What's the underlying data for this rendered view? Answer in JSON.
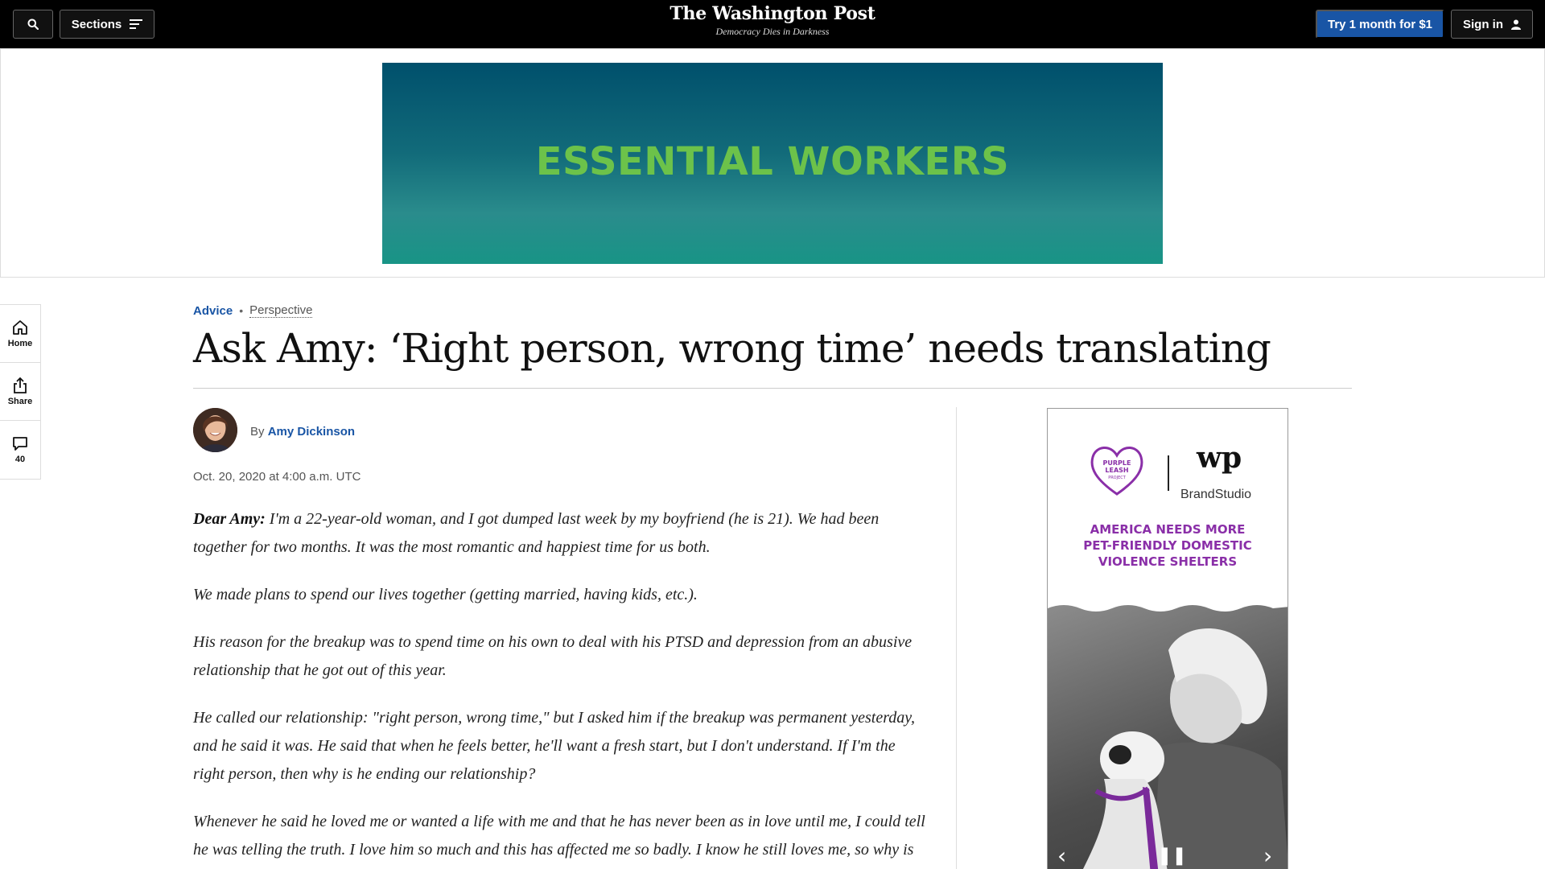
{
  "nav": {
    "sections_label": "Sections",
    "logo_title": "The Washington Post",
    "logo_tagline": "Democracy Dies in Darkness",
    "try_label": "Try 1 month for $1",
    "signin_label": "Sign in"
  },
  "top_ad": {
    "text": "ESSENTIAL WORKERS",
    "accent": "#6cc24a"
  },
  "rail": {
    "home_label": "Home",
    "share_label": "Share",
    "comments_count": "40"
  },
  "article": {
    "section": "Advice",
    "label": "Perspective",
    "headline": "Ask Amy: ‘Right person, wrong time’ needs translating",
    "byline_prefix": "By",
    "author": "Amy Dickinson",
    "date": "Oct. 20, 2020 at 4:00 a.m. UTC",
    "salutation": "Dear Amy:",
    "paragraphs": [
      " I'm a 22-year-old woman, and I got dumped last week by my boyfriend (he is 21). We had been together for two months. It was the most romantic and happiest time for us both.",
      "We made plans to spend our lives together (getting married, having kids, etc.).",
      "His reason for the breakup was to spend time on his own to deal with his PTSD and depression from an abusive relationship that he got out of this year.",
      "He called our relationship: \"right person, wrong time,\" but I asked him if the breakup was permanent yesterday, and he said it was. He said that when he feels better, he'll want a fresh start, but I don't understand. If I'm the right person, then why is he ending our relationship?",
      "Whenever he said he loved me or wanted a life with me and that he has never been as in love until me, I could tell he was telling the truth. I love him so much and this has affected me so badly. I know he still loves me, so why is"
    ]
  },
  "side_ad": {
    "partner_line1": "PURPLE",
    "partner_line2": "LEASH",
    "partner_line3": "PROJECT",
    "brand_mark": "wp",
    "brand": "BrandStudio",
    "headline_line1": "AMERICA NEEDS MORE",
    "headline_line2": "PET-FRIENDLY DOMESTIC",
    "headline_line3": "VIOLENCE SHELTERS",
    "accent": "#8a2fa8"
  },
  "colors": {
    "link_blue": "#1955a5",
    "nav_black": "#000000"
  }
}
